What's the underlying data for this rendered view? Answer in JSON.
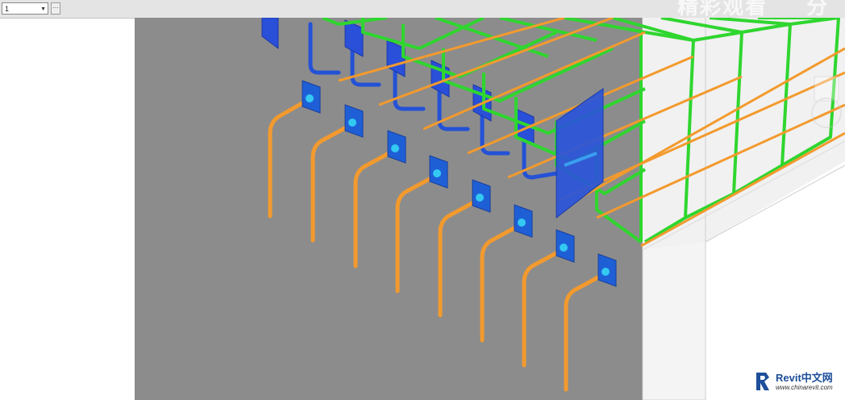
{
  "toolbar": {
    "type_selector_value": "1",
    "overlay_title": "精彩观看",
    "overlay_title_2": "分享"
  },
  "colors": {
    "top_bar_rebar": "#f39a2e",
    "stirrup": "#2fd62f",
    "anchor_bar": "#f39a2e",
    "anchor_plate": "#1f5fd6",
    "anchor_plate_upper": "#2a4fd8",
    "connector": "#33c9f2",
    "wall": "#8c8c8c",
    "slab": "#f2f2f2"
  },
  "watermark": {
    "brand": "Revit中文网",
    "url": "www.chinarevit.com",
    "icon": "revit-r-icon"
  }
}
